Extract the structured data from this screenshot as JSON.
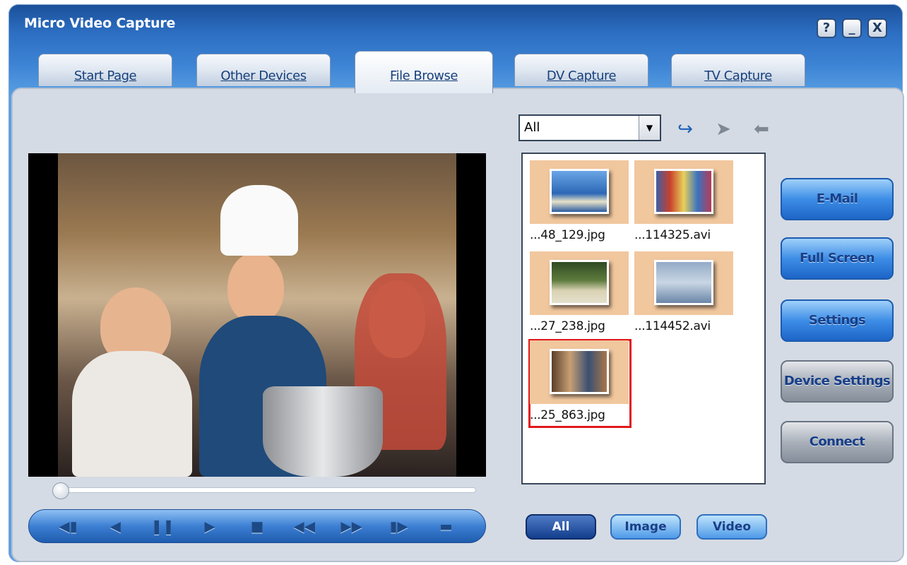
{
  "window": {
    "title": "Micro Video Capture",
    "help_icon": "?",
    "minimize_icon": "_",
    "close_icon": "X"
  },
  "tabs": [
    {
      "label": "Start Page"
    },
    {
      "label": "Other Devices"
    },
    {
      "label": "File Browse",
      "active": true
    },
    {
      "label": "DV Capture"
    },
    {
      "label": "TV Capture"
    }
  ],
  "player": {
    "controls": [
      {
        "name": "previous-frame",
        "glyph": "◀▮"
      },
      {
        "name": "step-back",
        "glyph": "◀"
      },
      {
        "name": "pause",
        "glyph": "❚❚"
      },
      {
        "name": "play",
        "glyph": "▶"
      },
      {
        "name": "stop",
        "glyph": "■"
      },
      {
        "name": "rewind",
        "glyph": "◀◀"
      },
      {
        "name": "fast-forward",
        "glyph": "▶▶"
      },
      {
        "name": "next-frame",
        "glyph": "▮▶"
      },
      {
        "name": "record",
        "glyph": "▬"
      }
    ],
    "position_fraction": 0.0
  },
  "browser": {
    "filter_value": "All",
    "toolbar_icons": [
      "back-arrow-icon",
      "send-icon",
      "receive-icon"
    ],
    "files": [
      {
        "name": "...48_129.jpg",
        "thumb": "#3d79c8"
      },
      {
        "name": "...114325.avi",
        "thumb": "#5a7db8"
      },
      {
        "name": "...27_238.jpg",
        "thumb": "#4e6a3a"
      },
      {
        "name": "...114452.avi",
        "thumb": "#7a93b6"
      },
      {
        "name": "...25_863.jpg",
        "thumb": "#7b5a3c",
        "selected": true
      }
    ],
    "filter_buttons": [
      {
        "label": "All"
      },
      {
        "label": "Image"
      },
      {
        "label": "Video"
      }
    ]
  },
  "actions": [
    {
      "label": "E-Mail"
    },
    {
      "label": "Full Screen"
    },
    {
      "label": "Settings"
    },
    {
      "label": "Device Settings"
    },
    {
      "label": "Connect"
    }
  ],
  "colors": {
    "title_bar": "#2c6ec2",
    "panel": "#d5dbe4",
    "selection": "#e0191b",
    "thumb_bg": "#f1c79e"
  }
}
